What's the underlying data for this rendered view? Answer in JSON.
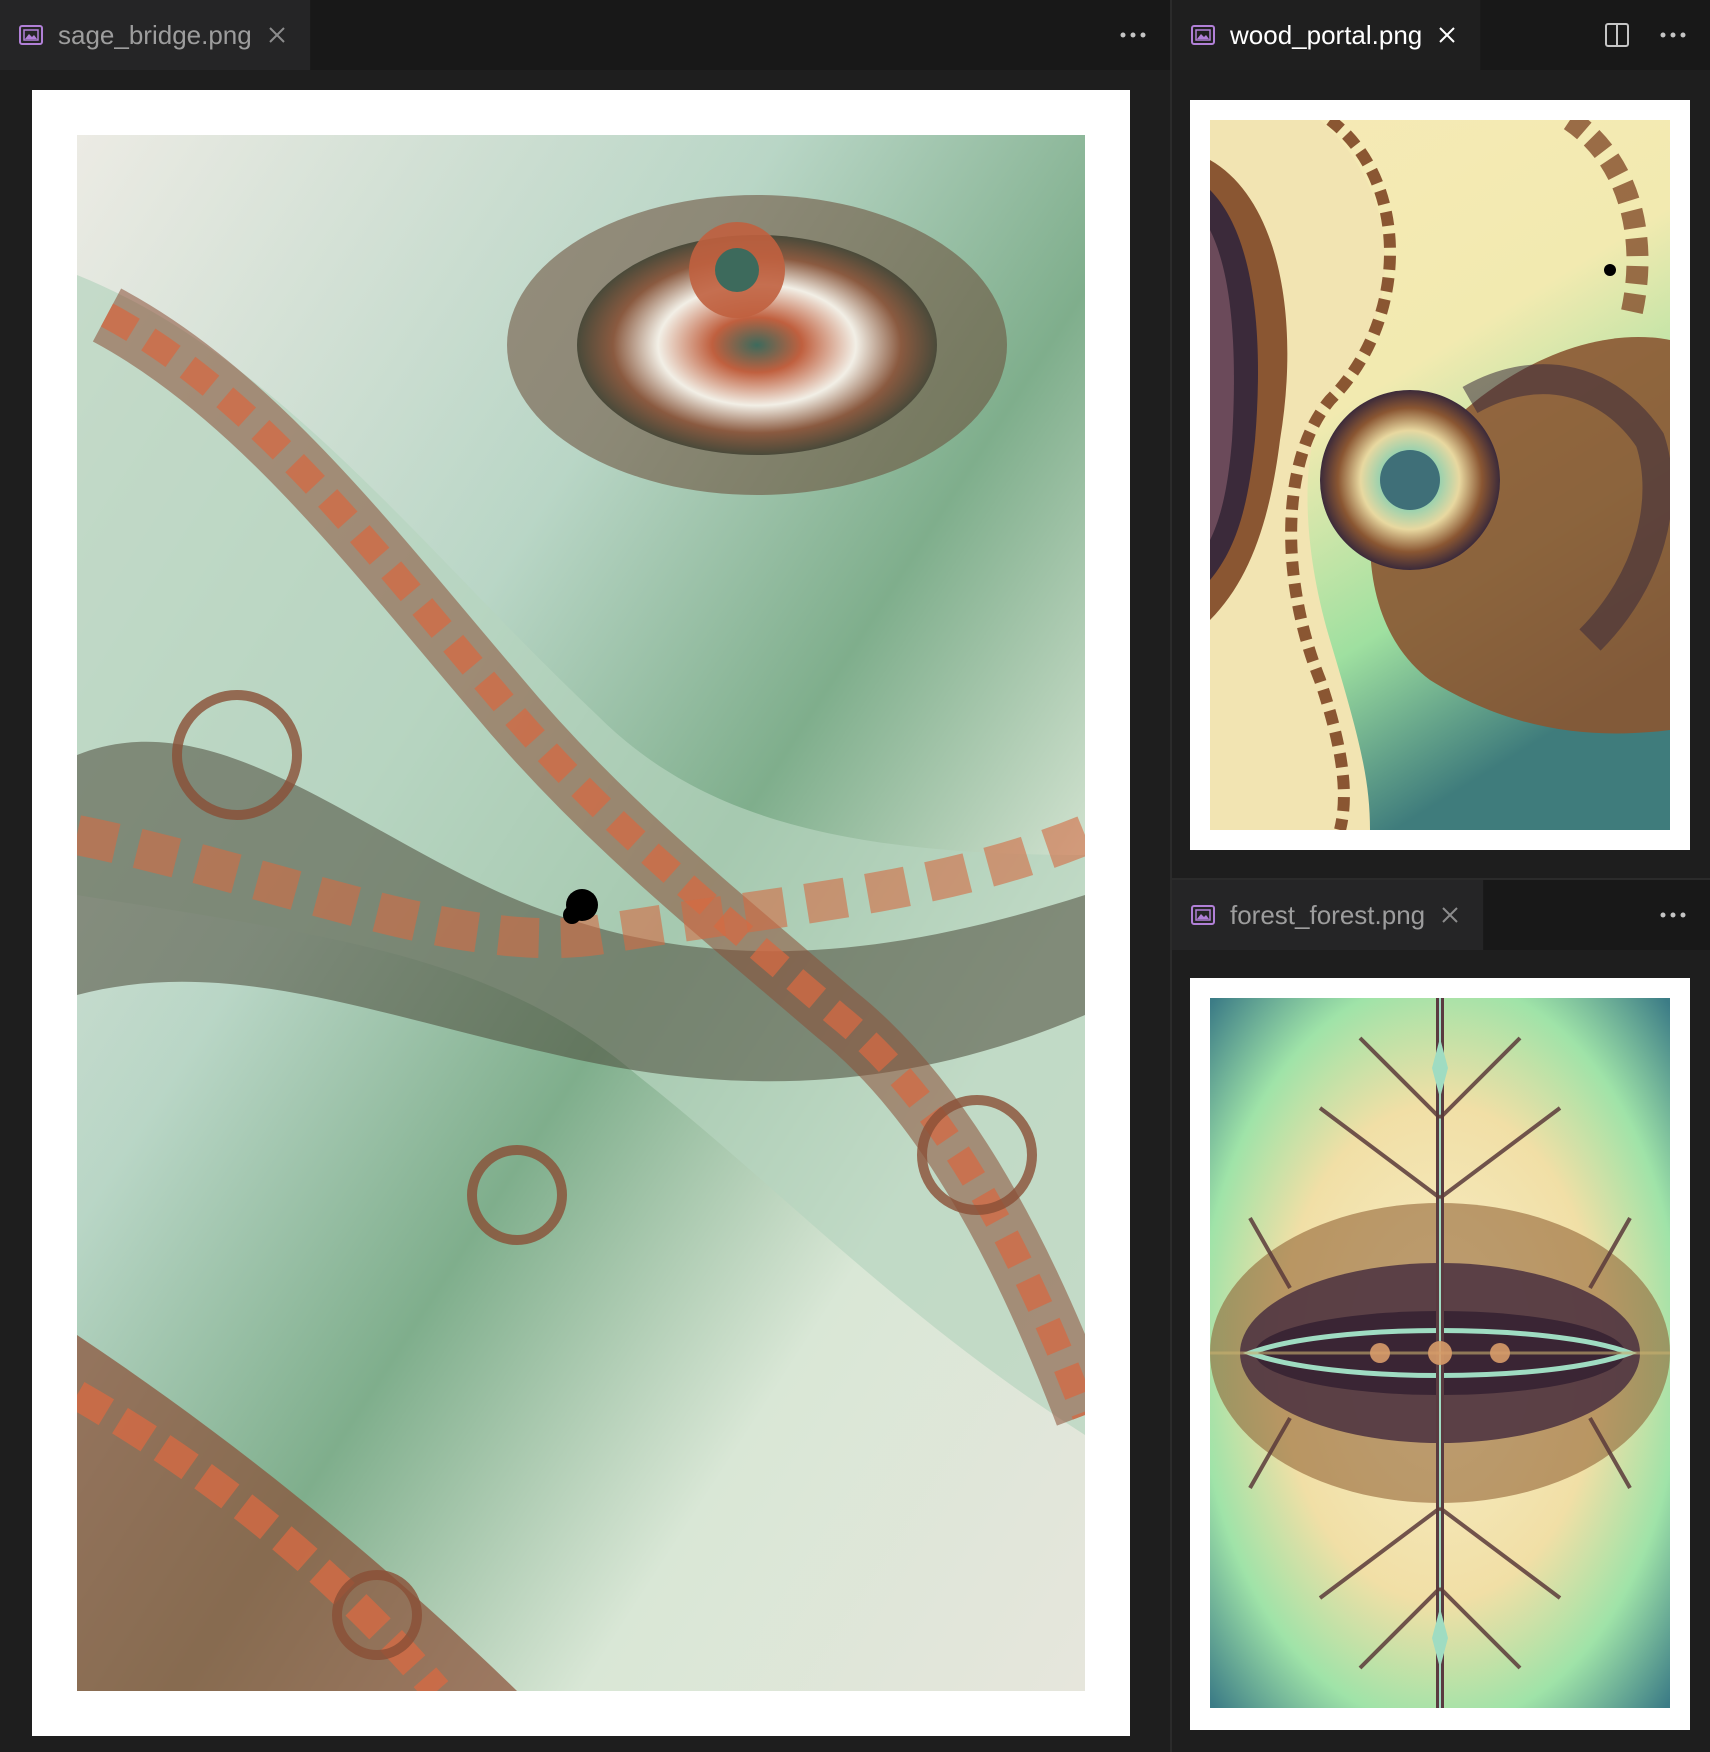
{
  "editor_groups": {
    "left": {
      "tab": {
        "label": "sage_bridge.png",
        "active": false
      },
      "actions": {
        "more_label": "···"
      },
      "image_name": "sage_bridge.png"
    },
    "top_right": {
      "tab": {
        "label": "wood_portal.png",
        "active": true
      },
      "actions": {
        "split_label": "",
        "more_label": "···"
      },
      "image_name": "wood_portal.png"
    },
    "bottom_right": {
      "tab": {
        "label": "forest_forest.png",
        "active": false
      },
      "actions": {
        "more_label": "···"
      },
      "image_name": "forest_forest.png"
    }
  },
  "colors": {
    "tab_icon": "#b180d7",
    "sage_bg": "#d6e4d2",
    "sage_copper": "#d46a43",
    "sage_dark": "#4a4a3a",
    "wood_cream": "#f4e8b8",
    "wood_brown": "#8a5632",
    "wood_purple": "#3b2a3a",
    "wood_teal": "#3f7c7c",
    "forest_teal": "#3c7c86",
    "forest_cream": "#f8efc8",
    "forest_dark": "#3a2534"
  }
}
